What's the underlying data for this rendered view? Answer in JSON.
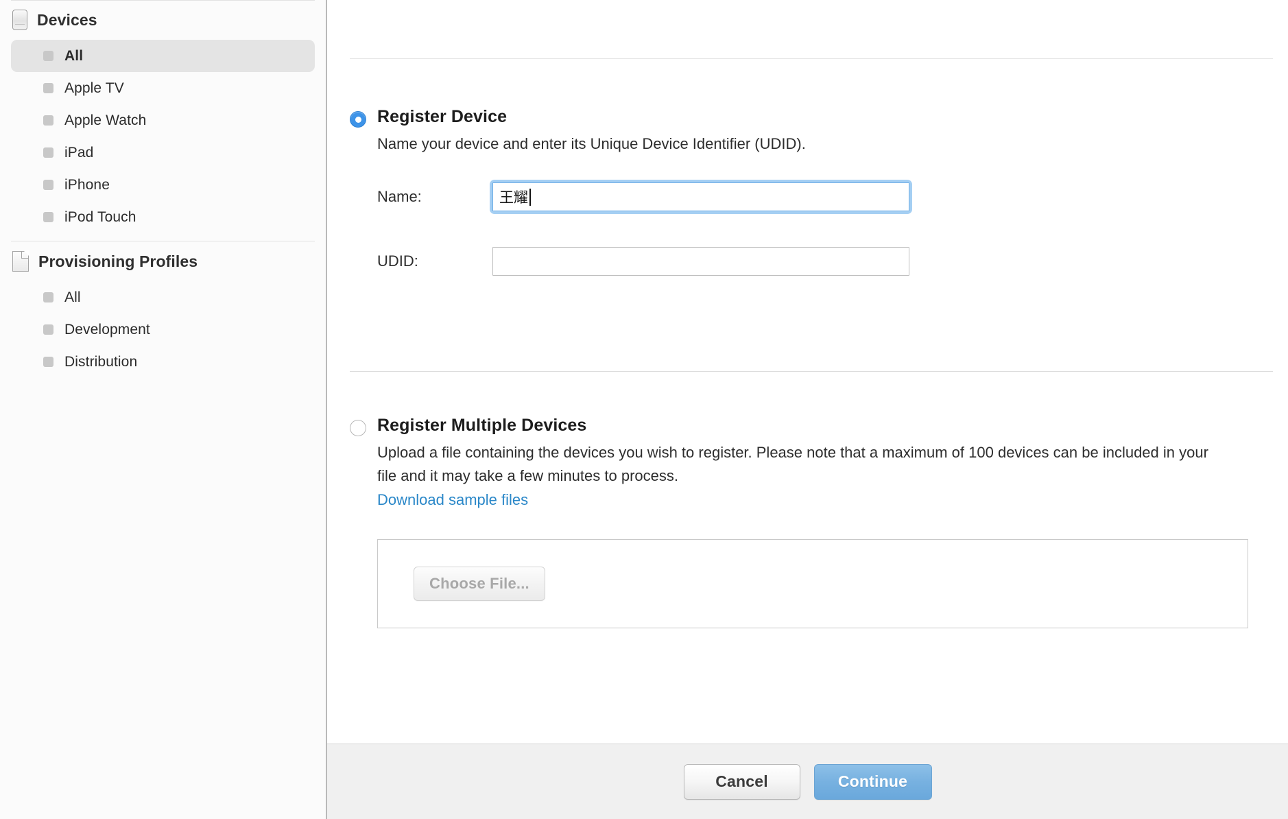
{
  "sidebar": {
    "groups": [
      {
        "title": "Devices",
        "icon": "device-icon",
        "items": [
          {
            "label": "All",
            "selected": true
          },
          {
            "label": "Apple TV",
            "selected": false
          },
          {
            "label": "Apple Watch",
            "selected": false
          },
          {
            "label": "iPad",
            "selected": false
          },
          {
            "label": "iPhone",
            "selected": false
          },
          {
            "label": "iPod Touch",
            "selected": false
          }
        ]
      },
      {
        "title": "Provisioning Profiles",
        "icon": "document-icon",
        "items": [
          {
            "label": "All",
            "selected": false
          },
          {
            "label": "Development",
            "selected": false
          },
          {
            "label": "Distribution",
            "selected": false
          }
        ]
      }
    ]
  },
  "main": {
    "register_device": {
      "selected": true,
      "title": "Register Device",
      "description": "Name your device and enter its Unique Device Identifier (UDID).",
      "fields": [
        {
          "label": "Name:",
          "value": "王耀",
          "placeholder": "",
          "focused": true
        },
        {
          "label": "UDID:",
          "value": "",
          "placeholder": "",
          "focused": false
        }
      ]
    },
    "register_multiple": {
      "selected": false,
      "title": "Register Multiple Devices",
      "description": "Upload a file containing the devices you wish to register. Please note that a maximum of 100 devices can be included in your file and it may take a few minutes to process.",
      "link_label": "Download sample files",
      "choose_file_label": "Choose File..."
    }
  },
  "footer": {
    "cancel_label": "Cancel",
    "continue_label": "Continue"
  },
  "colors": {
    "accent_radio": "#3d93e8",
    "link": "#2a87c8",
    "continue_button": "#77b1e0",
    "sidebar_bg": "#fbfbfb",
    "selected_row": "#e4e4e4",
    "footer_bg": "#f0f0f0"
  }
}
